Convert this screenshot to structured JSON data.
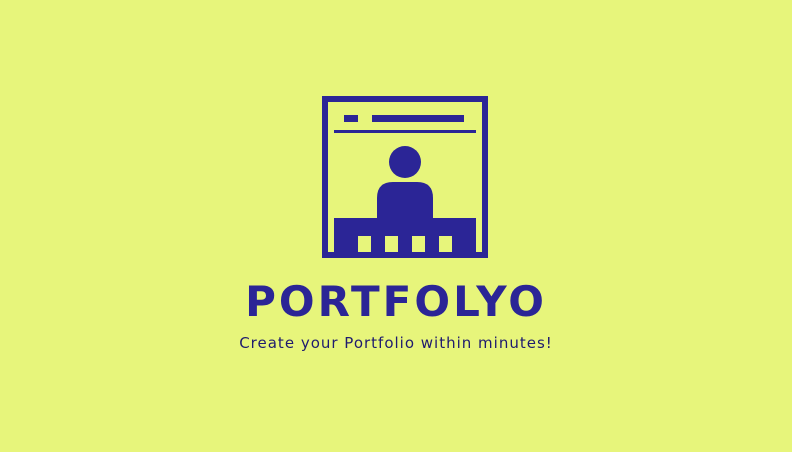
{
  "brand": {
    "name": "PORTFOLYO",
    "tagline": "Create your Portfolio within minutes!"
  },
  "icons": {
    "logo": "portfolio-profile-window-icon"
  },
  "colors": {
    "background": "#e7f57b",
    "brand": "#2b2596"
  }
}
